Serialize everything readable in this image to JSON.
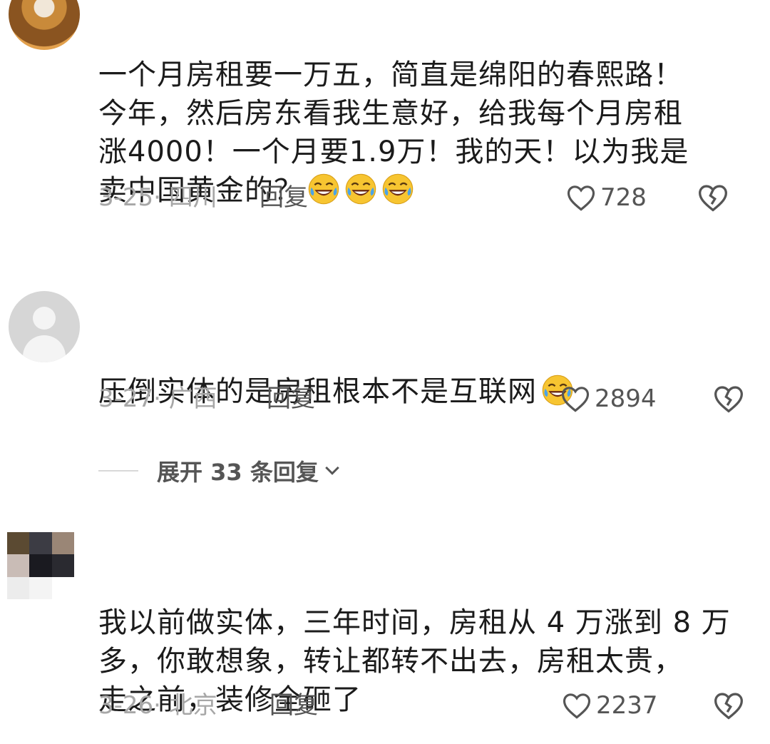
{
  "comments": [
    {
      "text": "一个月房租要一万五，简直是绵阳的春熙路！\n今年，然后房东看我生意好，给我每个月房租\n涨4000！一个月要1.9万！我的天！以为我是\n卖中国黄金的？",
      "emoji_count": 3,
      "date": "3-25",
      "location": "四川",
      "reply_label": "回复",
      "likes": "728"
    },
    {
      "text": "压倒实体的是房租根本不是互联网",
      "emoji_count": 1,
      "date": "3-27",
      "location": "广西",
      "reply_label": "回复",
      "likes": "2894",
      "expand_label": "展开 33 条回复"
    },
    {
      "text": "我以前做实体，三年时间，房租从 4 万涨到 8 万\n多，你敢想象，转让都转不出去，房租太贵，\n走之前，装修全砸了",
      "emoji_count": 0,
      "date": "3-26",
      "location": "北京",
      "reply_label": "回复",
      "likes": "2237"
    }
  ],
  "icons": {
    "like": "heart-outline-icon",
    "dislike": "broken-heart-icon",
    "emoji": "rofl-emoji-icon",
    "expand": "chevron-down-icon"
  },
  "colors": {
    "text": "#1b1b1b",
    "meta": "#a7a7a7",
    "action": "#555555"
  }
}
